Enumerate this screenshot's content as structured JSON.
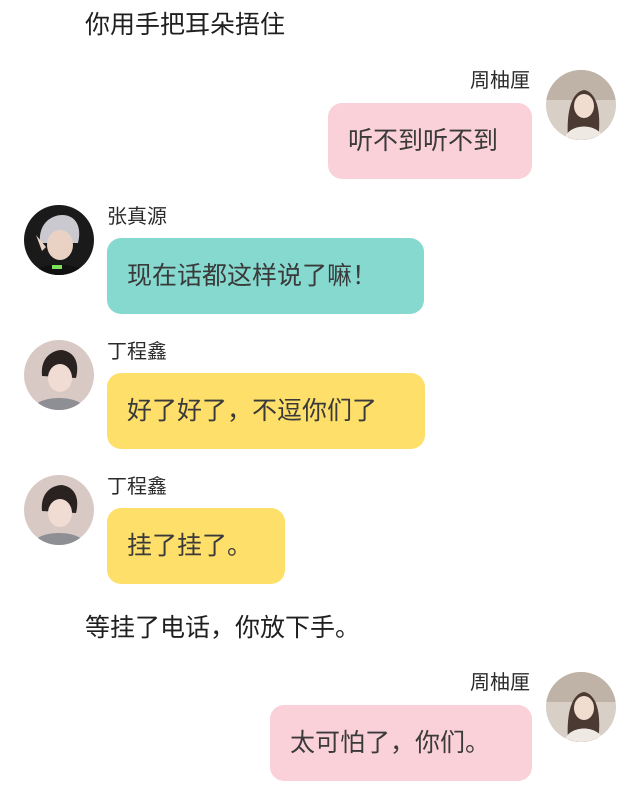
{
  "narration": [
    "你用手把耳朵捂住",
    "等挂了电话，你放下手。"
  ],
  "messages": [
    {
      "sender": "周柚厘",
      "text": "听不到听不到",
      "side": "right",
      "bubble_color": "#fbd1d9"
    },
    {
      "sender": "张真源",
      "text": "现在话都这样说了嘛！",
      "side": "left",
      "bubble_color": "#85d9cf"
    },
    {
      "sender": "丁程鑫",
      "text": "好了好了，不逗你们了",
      "side": "left",
      "bubble_color": "#fedf69"
    },
    {
      "sender": "丁程鑫",
      "text": "挂了挂了。",
      "side": "left",
      "bubble_color": "#fedf69"
    },
    {
      "sender": "周柚厘",
      "text": "太可怕了，你们。",
      "side": "right",
      "bubble_color": "#fbd1d9"
    }
  ],
  "avatars": {
    "zhou": "girl-portrait-avatar",
    "zhang": "silver-hair-avatar",
    "ding": "dark-hair-avatar"
  }
}
